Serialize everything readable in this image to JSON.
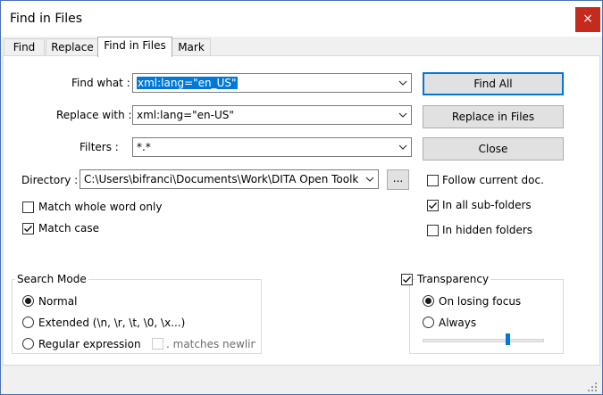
{
  "window": {
    "title": "Find in Files",
    "close_glyph": "×"
  },
  "tabs": [
    {
      "label": "Find"
    },
    {
      "label": "Replace"
    },
    {
      "label": "Find in Files"
    },
    {
      "label": "Mark"
    }
  ],
  "fields": {
    "find_what": {
      "label": "Find what :",
      "value": "xml:lang=\"en_US\""
    },
    "replace_with": {
      "label": "Replace with :",
      "value": "xml:lang=\"en-US\""
    },
    "filters": {
      "label": "Filters :",
      "value": "*.*"
    },
    "directory": {
      "label": "Directory :",
      "value": "C:\\Users\\bifranci\\Documents\\Work\\DITA Open Toolk",
      "browse_label": "..."
    }
  },
  "buttons": {
    "find_all": "Find All",
    "replace_in_files": "Replace in Files",
    "close": "Close"
  },
  "options": {
    "follow_current_doc": {
      "label": "Follow current doc.",
      "checked": false
    },
    "in_all_sub_folders": {
      "label": "In all sub-folders",
      "checked": true
    },
    "in_hidden_folders": {
      "label": "In hidden folders",
      "checked": false
    },
    "match_whole_word": {
      "label": "Match whole word only",
      "checked": false
    },
    "match_case": {
      "label": "Match case",
      "checked": true
    }
  },
  "search_mode": {
    "caption": "Search Mode",
    "normal": "Normal",
    "extended": "Extended (\\n, \\r, \\t, \\0, \\x...)",
    "regex": "Regular expression",
    "matches_newline": ". matches newline",
    "selected": "normal"
  },
  "transparency": {
    "caption": "Transparency",
    "checked": true,
    "on_losing_focus": "On losing focus",
    "always": "Always",
    "selected": "on_losing_focus",
    "level": 0.71
  },
  "colors": {
    "accent": "#0078d7",
    "close_red": "#c42b1c"
  },
  "icons": {
    "dropdown": "chevron-down-icon",
    "checkmark": "checkmark-icon",
    "resize": "resize-grip-icon"
  }
}
